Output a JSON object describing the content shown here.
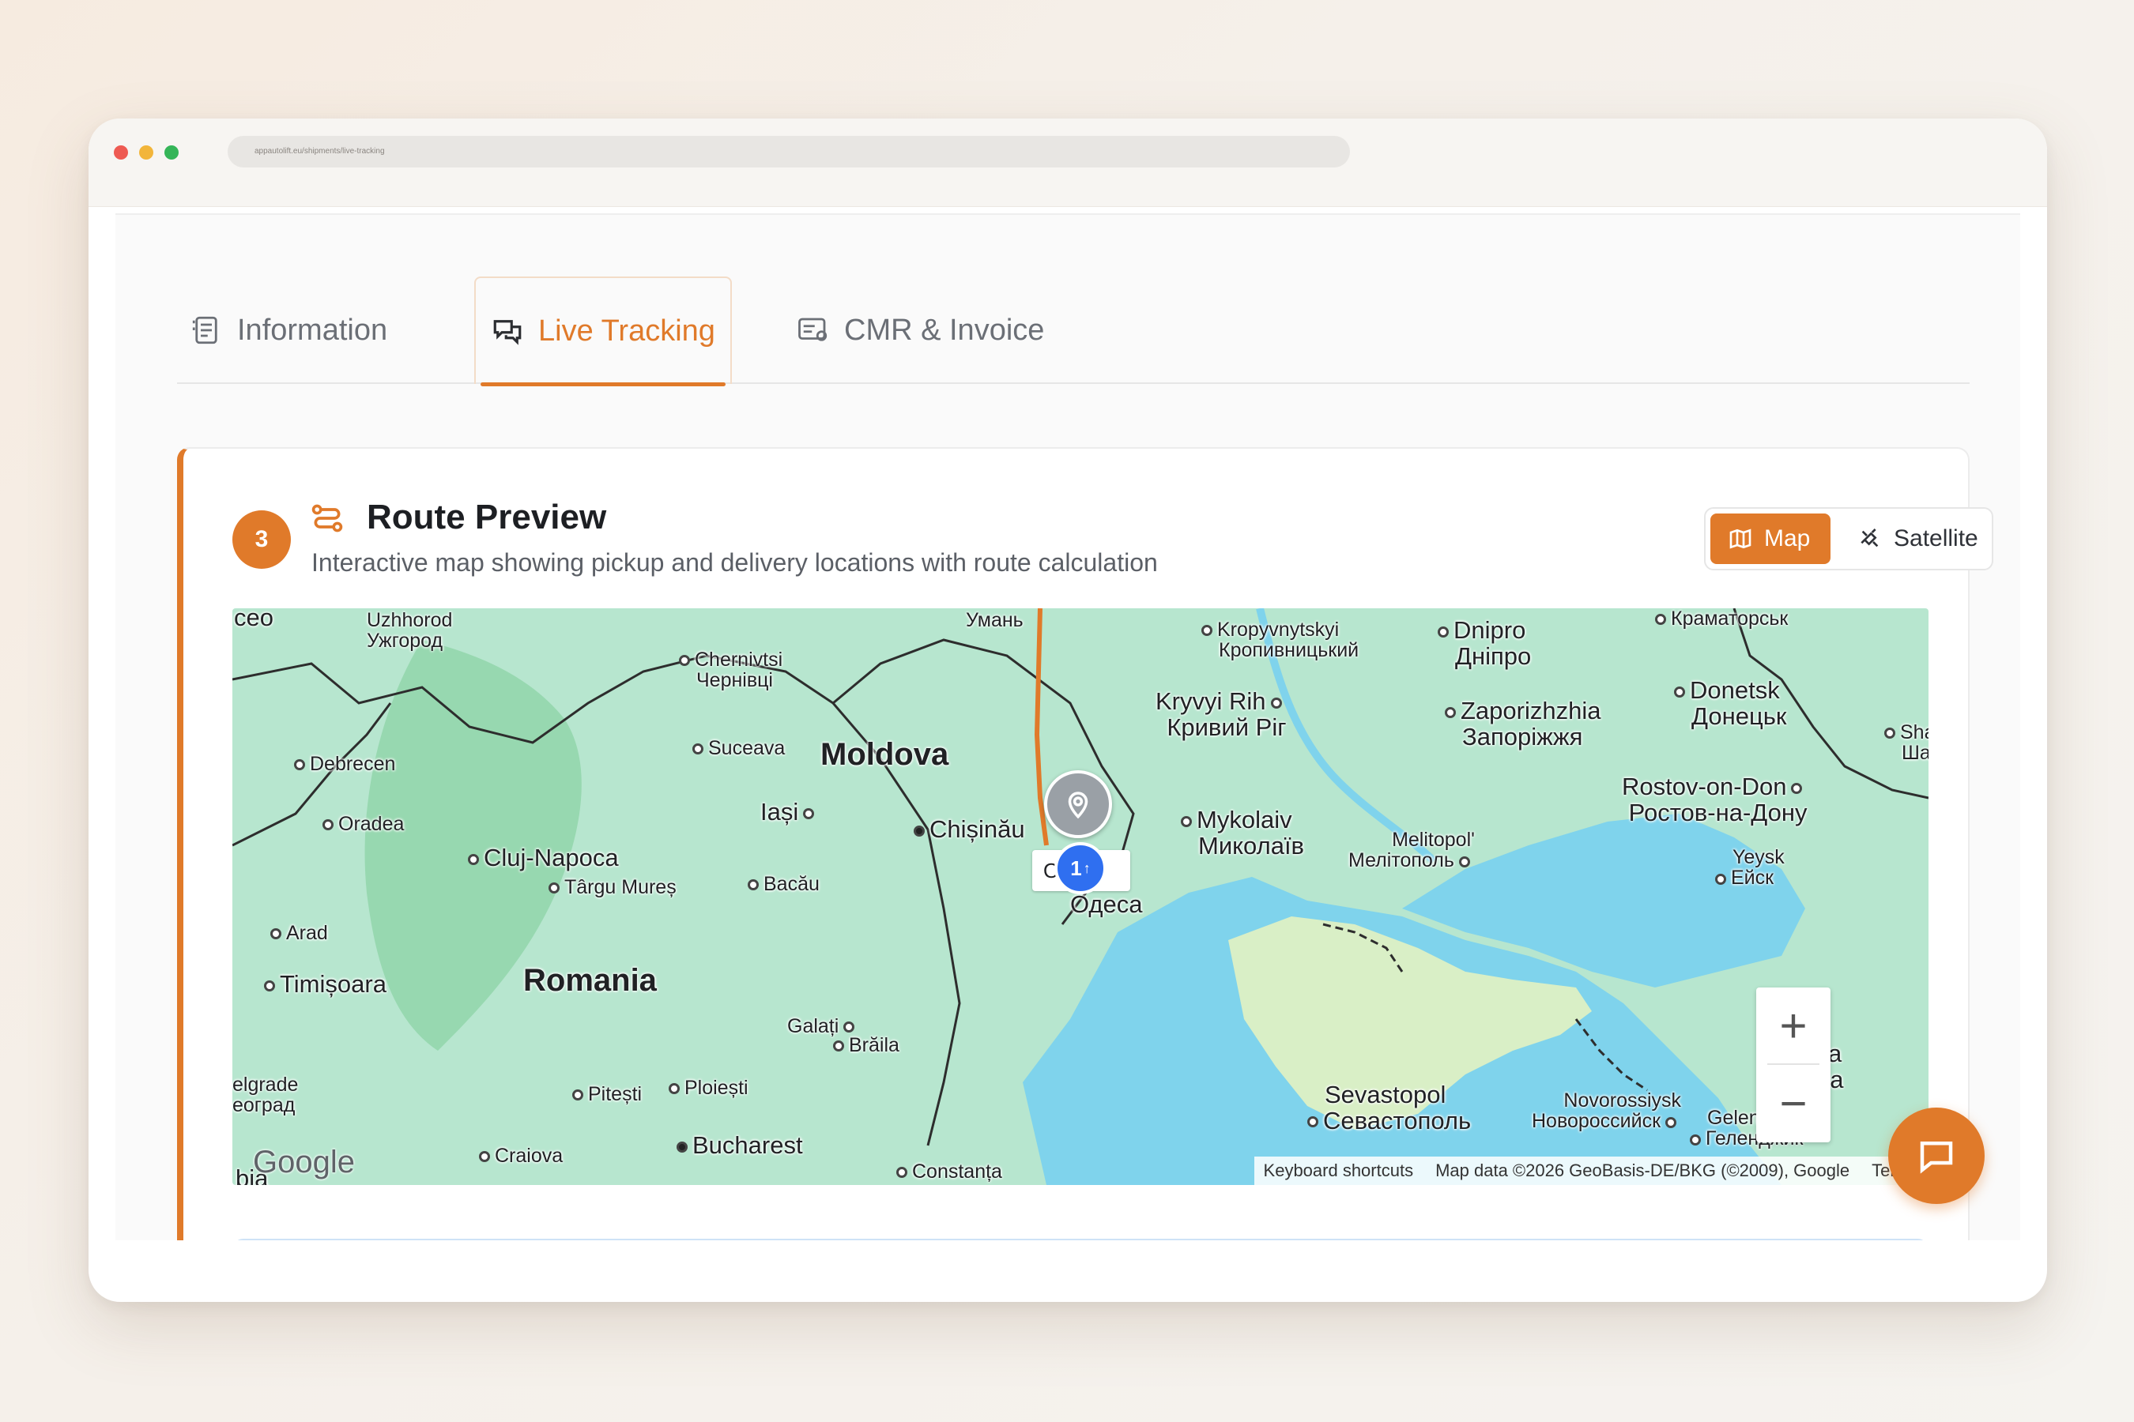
{
  "browser": {
    "url": "appautolift.eu/shipments/live-tracking"
  },
  "tabs": [
    {
      "label": "Information",
      "icon": "document-list-icon"
    },
    {
      "label": "Live Tracking",
      "icon": "chat-bubbles-icon",
      "active": true
    },
    {
      "label": "CMR & Invoice",
      "icon": "invoice-icon"
    }
  ],
  "route_card": {
    "step": "3",
    "title": "Route Preview",
    "subtitle": "Interactive map showing pickup and delivery locations with route calculation",
    "view_toggle": {
      "map_label": "Map",
      "satellite_label": "Satellite",
      "selected": "Map"
    }
  },
  "map": {
    "labels": {
      "uzhhorod": "Uzhhorod",
      "uzhhorod_cyr": "Ужгород",
      "chernivtsi": "Chernivtsi",
      "chernivtsi_cyr": "Чернівці",
      "uman": "Умань",
      "kropyvnytskyi": "Kropyvnytskyi",
      "kropyvnytskyi_cyr": "Кропивницький",
      "dnipro": "Dnipro",
      "dnipro_cyr": "Дніпро",
      "kramatorsk_cyr": "Краматорськ",
      "kryvyi_rih": "Kryvyi Rih",
      "kryvyi_rih_cyr": "Кривий Ріг",
      "zaporizhzhia": "Zaporizhzhia",
      "zaporizhzhia_cyr": "Запоріжжя",
      "donetsk": "Donetsk",
      "donetsk_cyr": "Донецьк",
      "debrecen": "Debrecen",
      "suceava": "Suceava",
      "moldova": "Moldova",
      "oradea": "Oradea",
      "iasi": "Iași",
      "chisinau": "Chișinău",
      "mykolaiv": "Mykolaiv",
      "mykolaiv_cyr": "Миколаїв",
      "melitopol": "Melitopol'",
      "melitopol_cyr": "Мелітополь",
      "rostov": "Rostov-on-Don",
      "rostov_cyr": "Ростов-на-Дону",
      "cluj": "Cluj-Napoca",
      "targu_mures": "Târgu Mureș",
      "bacau": "Bacău",
      "odesa": "esa",
      "odesa_cyr": "Одеса",
      "yeysk": "Yeysk",
      "yeysk_cyr": "Ейск",
      "arad": "Arad",
      "timisoara": "Timișoara",
      "romania": "Romania",
      "galati": "Galați",
      "braila": "Brăila",
      "pitesti": "Pitești",
      "ploiesti": "Ploiești",
      "craiova": "Craiova",
      "bucharest": "Bucharest",
      "constanta": "Constanța",
      "sevastopol": "Sevastopol",
      "sevastopol_cyr": "Севастополь",
      "novorossiysk": "Novorossiysk",
      "novorossiysk_cyr": "Новороссийск",
      "gelendzhik": "Gelendzhik",
      "gelendzhik_cyr": "Геленджик",
      "kra": "Kra",
      "kra_cyr": "Кра",
      "sha": "Sha",
      "sha_cyr": "Ша",
      "ceo": "ceo",
      "elgrade": "elgrade",
      "eograd": "еоград",
      "bia": "bia"
    },
    "marker_cluster_count": "1",
    "marker_tag_text": "O      r",
    "google_logo": "Google",
    "attribution": {
      "shortcuts": "Keyboard shortcuts",
      "data": "Map data ©2026 GeoBasis-DE/BKG (©2009), Google",
      "terms": "Terms"
    },
    "zoom_in": "+",
    "zoom_out": "−"
  },
  "colors": {
    "accent": "#e07a2a",
    "map_land": "#b7e6cf",
    "map_water": "#7fd3ec",
    "cluster": "#2f6ff0"
  }
}
